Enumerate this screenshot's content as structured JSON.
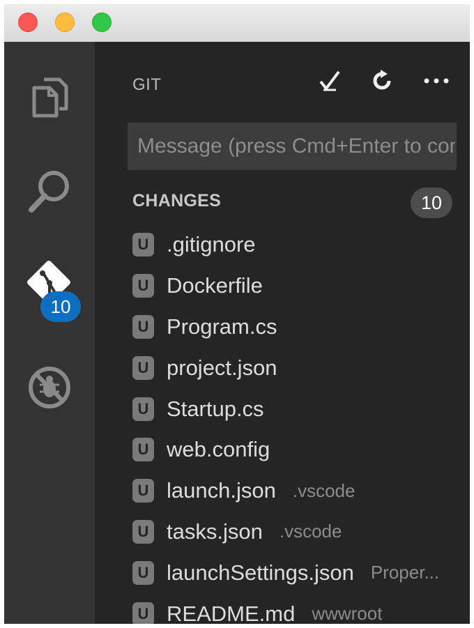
{
  "window": {
    "buttons": [
      "close",
      "minimize",
      "maximize"
    ],
    "colors": {
      "close": "#fc5753",
      "minimize": "#fdbc40",
      "maximize": "#33c748"
    }
  },
  "activity_bar": {
    "items": [
      {
        "name": "explorer",
        "icon": "files-icon"
      },
      {
        "name": "search",
        "icon": "search-icon"
      },
      {
        "name": "git",
        "icon": "git-icon",
        "active": true,
        "badge": "10"
      },
      {
        "name": "debug",
        "icon": "debug-icon"
      }
    ],
    "badge_color": "#0e6fc2"
  },
  "sidebar": {
    "title": "GIT",
    "actions": [
      {
        "name": "commit",
        "icon": "checkmark-icon"
      },
      {
        "name": "refresh",
        "icon": "refresh-icon"
      },
      {
        "name": "more",
        "icon": "ellipsis-icon"
      }
    ],
    "message_placeholder": "Message (press Cmd+Enter to commit)",
    "changes_label": "CHANGES",
    "changes_count": "10",
    "files": [
      {
        "status": "U",
        "name": ".gitignore",
        "dir": ""
      },
      {
        "status": "U",
        "name": "Dockerfile",
        "dir": ""
      },
      {
        "status": "U",
        "name": "Program.cs",
        "dir": ""
      },
      {
        "status": "U",
        "name": "project.json",
        "dir": ""
      },
      {
        "status": "U",
        "name": "Startup.cs",
        "dir": ""
      },
      {
        "status": "U",
        "name": "web.config",
        "dir": ""
      },
      {
        "status": "U",
        "name": "launch.json",
        "dir": ".vscode"
      },
      {
        "status": "U",
        "name": "tasks.json",
        "dir": ".vscode"
      },
      {
        "status": "U",
        "name": "launchSettings.json",
        "dir": "Proper..."
      },
      {
        "status": "U",
        "name": "README.md",
        "dir": "wwwroot"
      }
    ]
  }
}
